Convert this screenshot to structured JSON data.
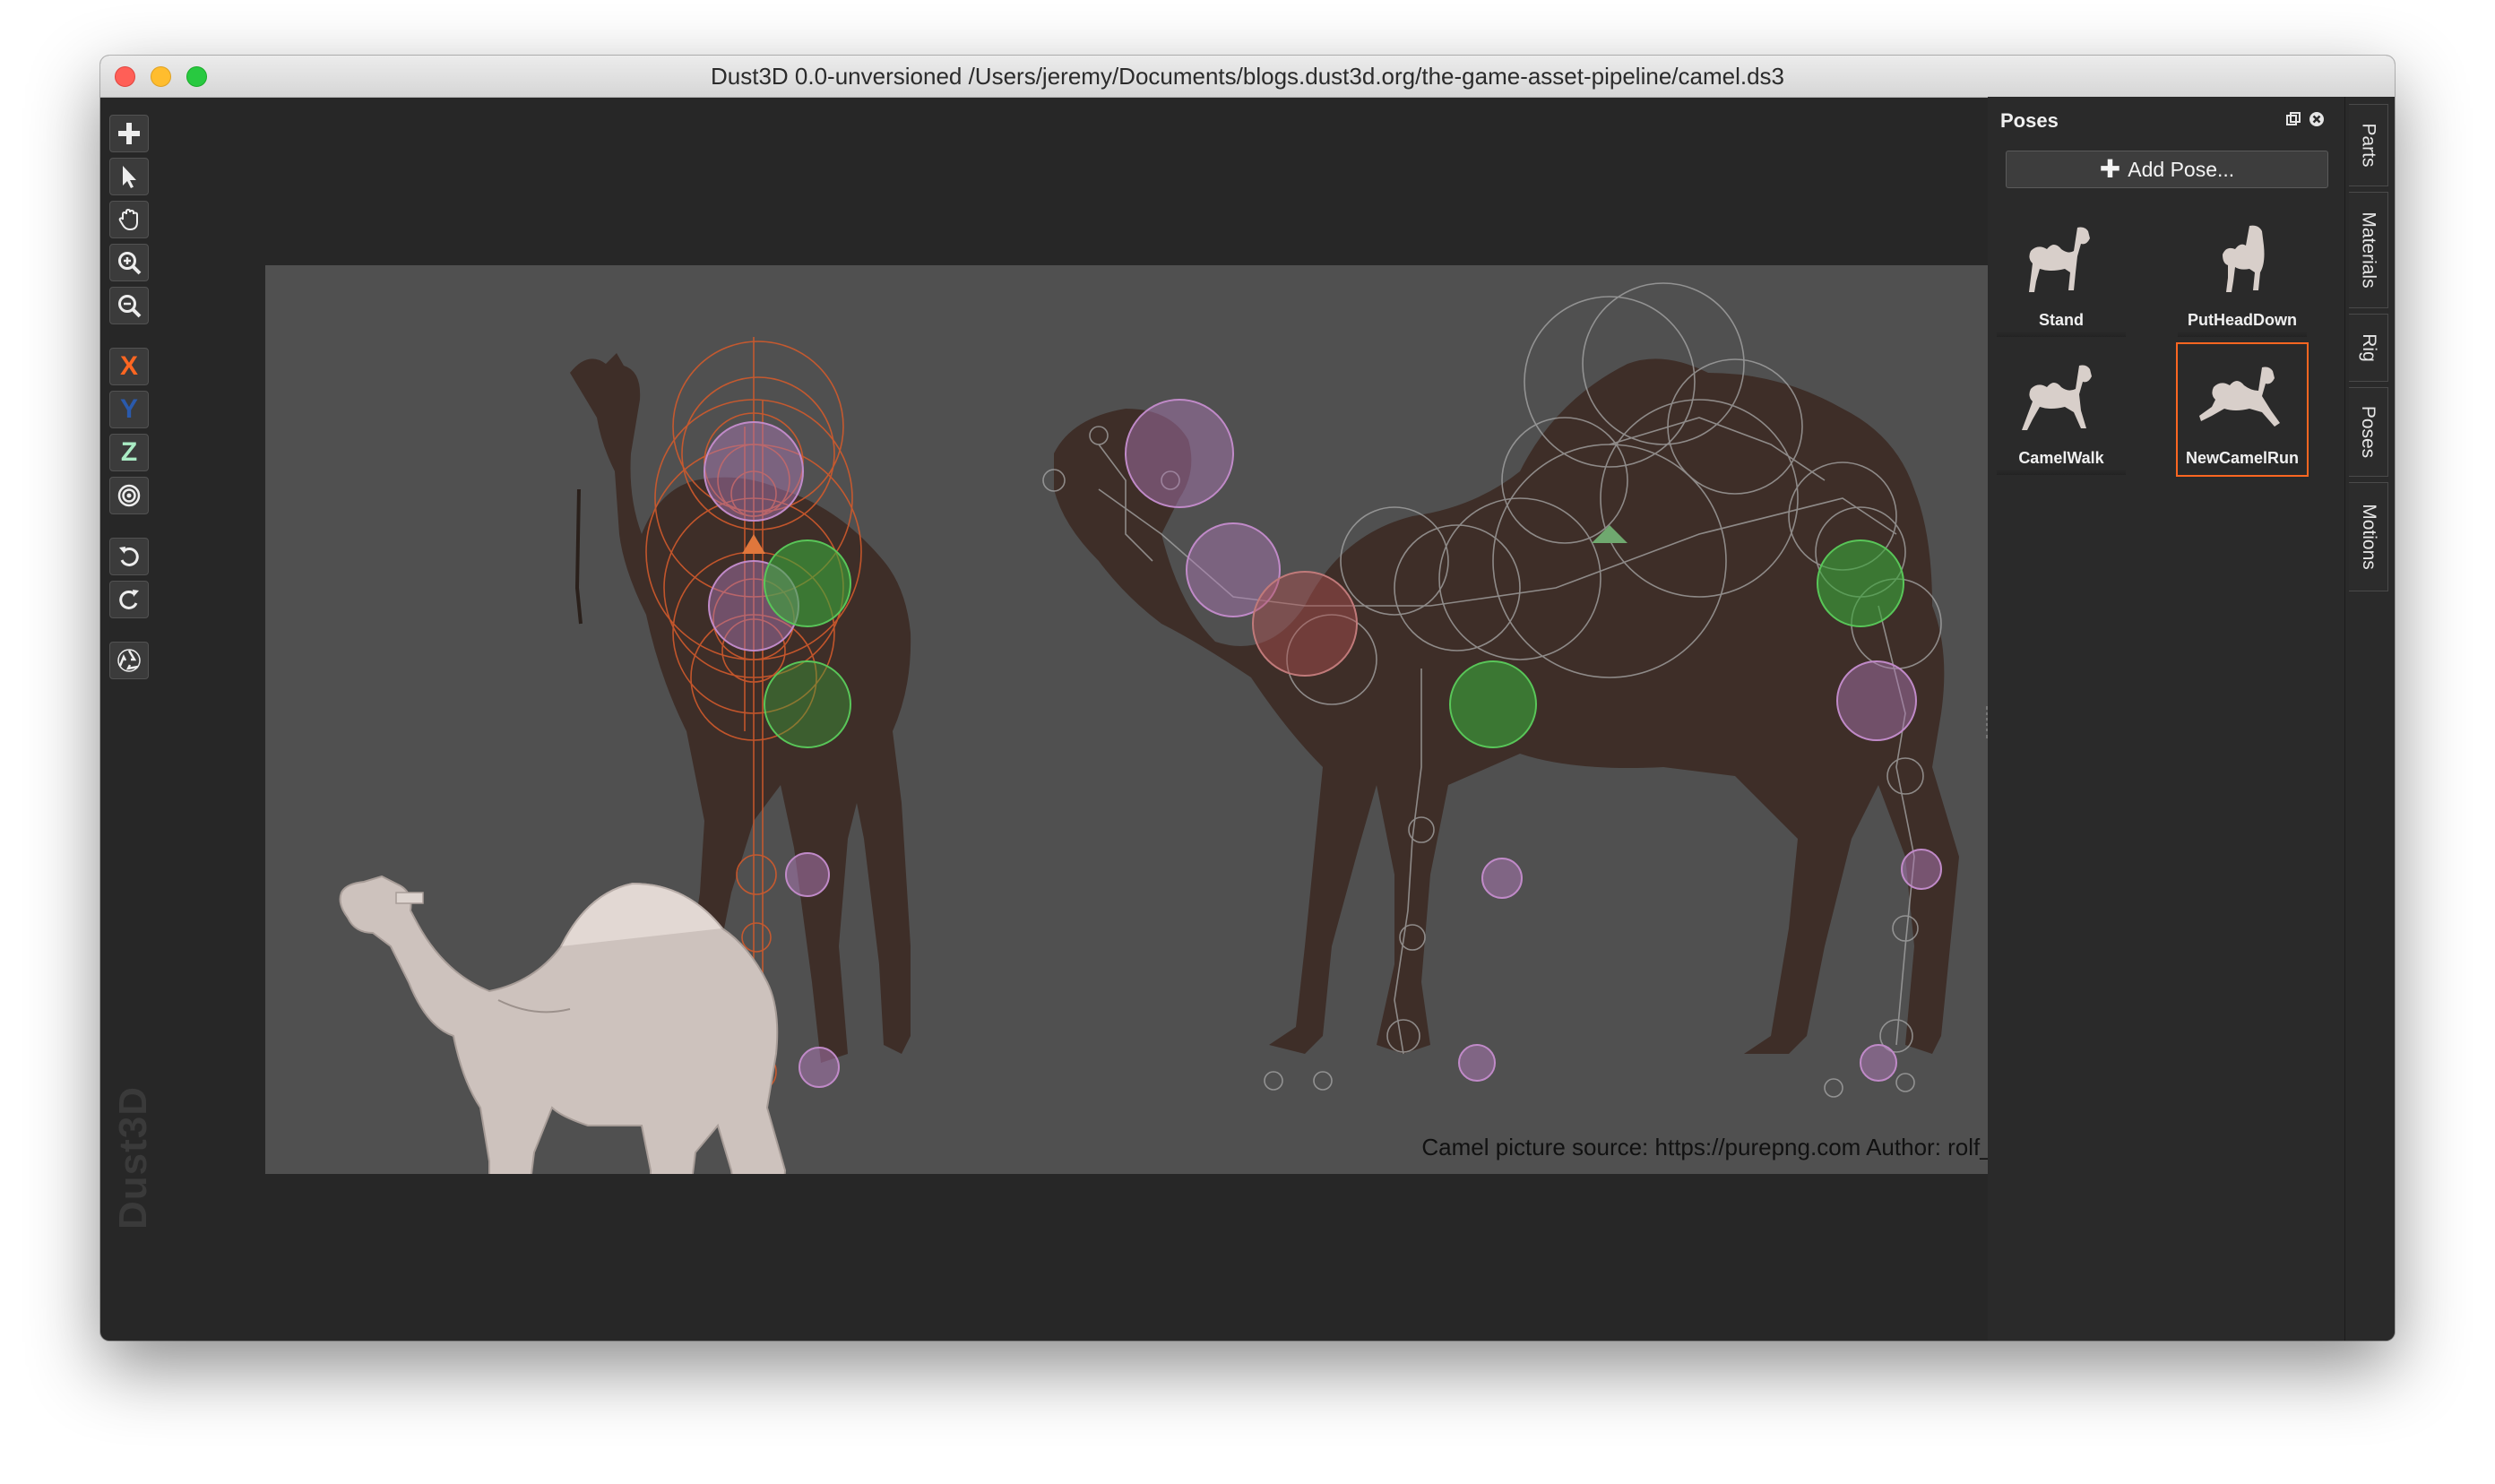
{
  "window": {
    "title": "Dust3D 0.0-unversioned /Users/jeremy/Documents/blogs.dust3d.org/the-game-asset-pipeline/camel.ds3"
  },
  "toolbar": {
    "items": [
      {
        "name": "add-node-button",
        "icon": "plus-icon"
      },
      {
        "name": "select-button",
        "icon": "pointer-arrow-icon"
      },
      {
        "name": "drag-button",
        "icon": "hand-icon"
      },
      {
        "name": "zoom-in-button",
        "icon": "zoom-in-icon"
      },
      {
        "name": "zoom-out-button",
        "icon": "zoom-out-icon"
      },
      {
        "name": "x-lock-button",
        "label": "X",
        "color": "#fc6621"
      },
      {
        "name": "y-lock-button",
        "label": "Y",
        "color": "#2a5aac"
      },
      {
        "name": "z-lock-button",
        "label": "Z",
        "color": "#aaebc4"
      },
      {
        "name": "radius-lock-button",
        "icon": "target-icon"
      },
      {
        "name": "undo-button",
        "icon": "undo-icon"
      },
      {
        "name": "redo-button",
        "icon": "redo-icon"
      },
      {
        "name": "recycle-button",
        "icon": "recycle-icon"
      }
    ],
    "watermark": "Dust3D"
  },
  "canvas": {
    "credit": "Camel picture source: https://purepng.com Author: rolf_nalder"
  },
  "poses_panel": {
    "title": "Poses",
    "add_label": "Add Pose...",
    "poses": [
      {
        "label": "Stand",
        "selected": false
      },
      {
        "label": "PutHeadDown",
        "selected": false
      },
      {
        "label": "CamelWalk",
        "selected": false
      },
      {
        "label": "NewCamelRun",
        "selected": true
      }
    ]
  },
  "side_tabs": [
    "Parts",
    "Materials",
    "Rig",
    "Poses",
    "Motions"
  ],
  "colors": {
    "accent_orange": "#fc6621",
    "green_node": "#3aa83a",
    "pink_node": "#b07ab8"
  }
}
